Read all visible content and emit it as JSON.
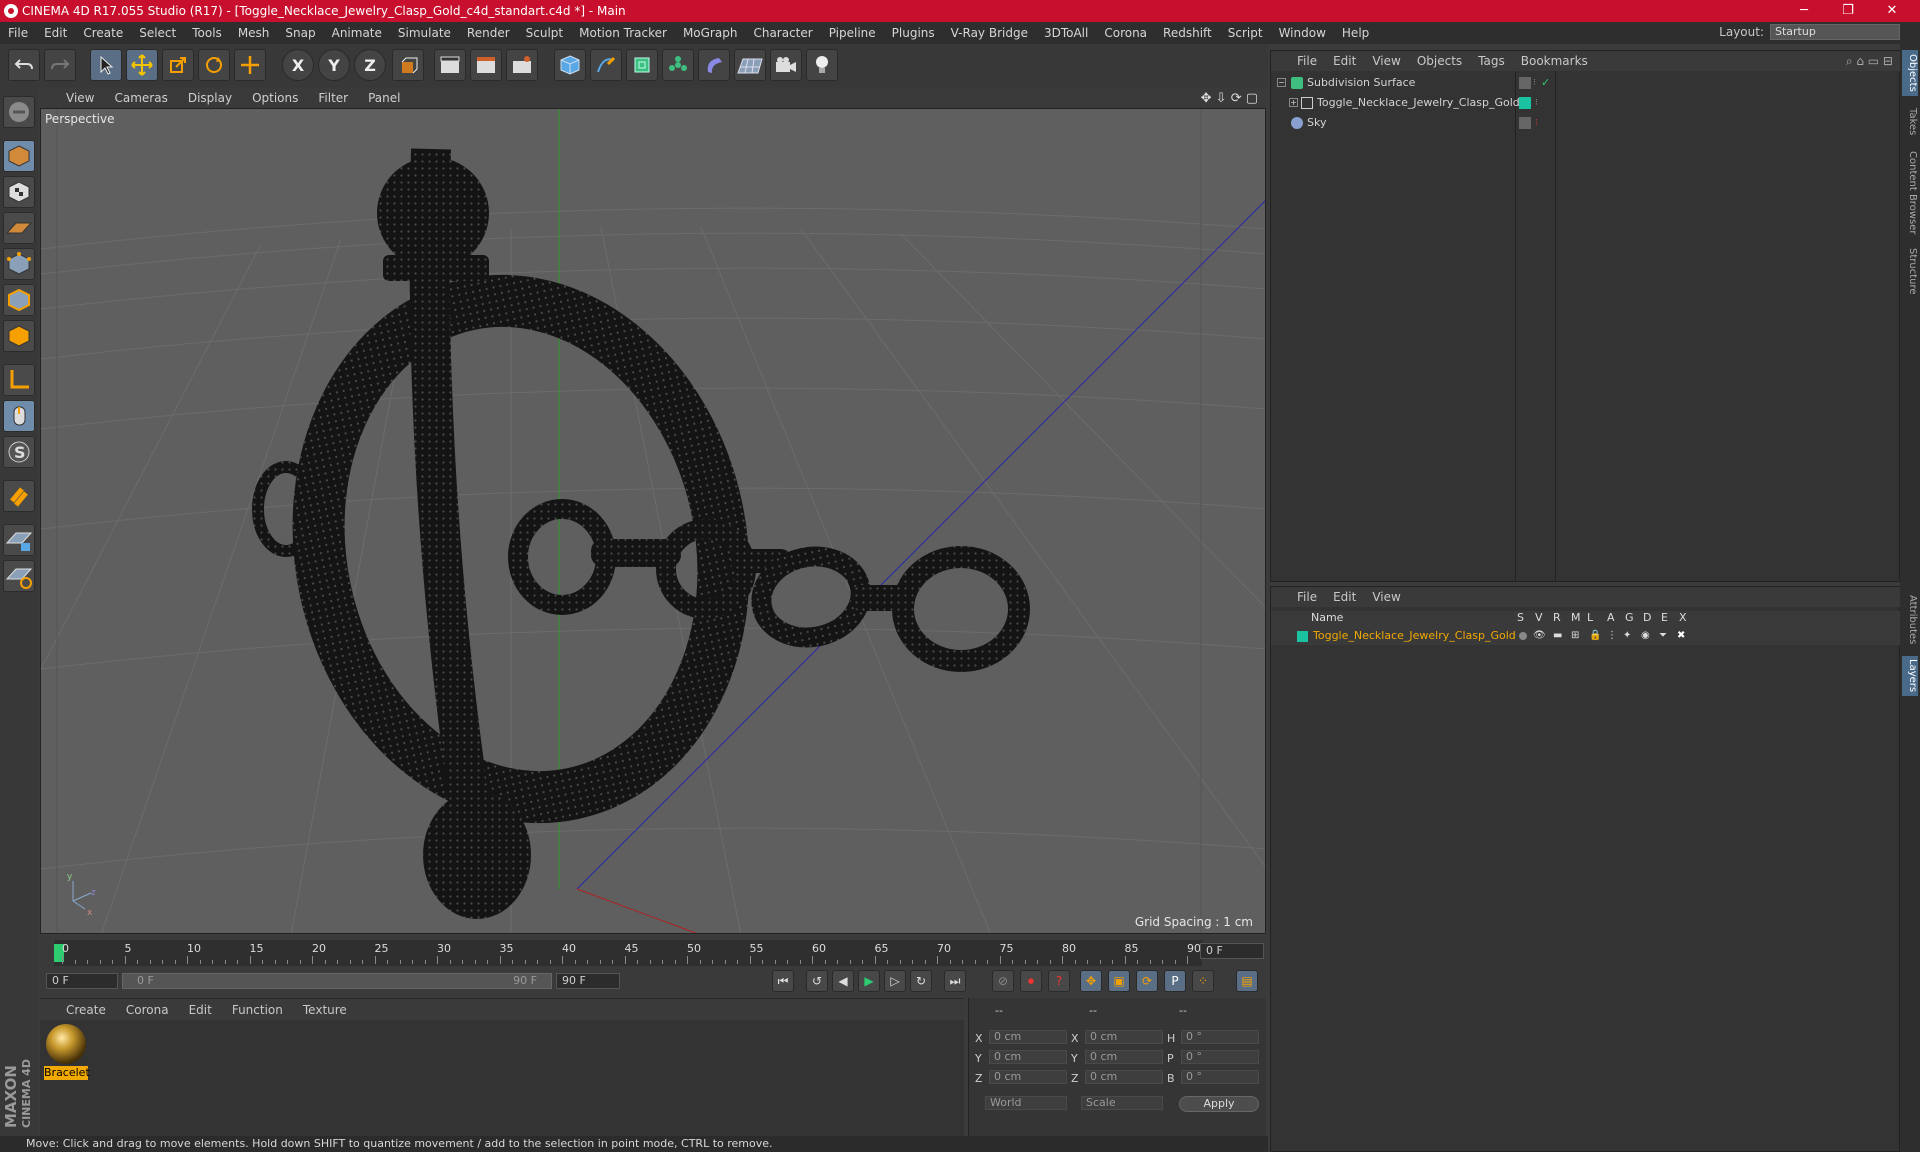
{
  "window": {
    "title": "CINEMA 4D R17.055 Studio (R17) - [Toggle_Necklace_Jewelry_Clasp_Gold_c4d_standart.c4d *] - Main",
    "minimize": "─",
    "maximize": "❐",
    "close": "✕"
  },
  "menubar": {
    "items": [
      "File",
      "Edit",
      "Create",
      "Select",
      "Tools",
      "Mesh",
      "Snap",
      "Animate",
      "Simulate",
      "Render",
      "Sculpt",
      "Motion Tracker",
      "MoGraph",
      "Character",
      "Pipeline",
      "Plugins",
      "V-Ray Bridge",
      "3DToAll",
      "Corona",
      "Redshift",
      "Script",
      "Window",
      "Help"
    ],
    "layout_label": "Layout:",
    "layout_value": "Startup"
  },
  "toolbar": {
    "axis_x": "X",
    "axis_y": "Y",
    "axis_z": "Z"
  },
  "viewport": {
    "menu": [
      "View",
      "Cameras",
      "Display",
      "Options",
      "Filter",
      "Panel"
    ],
    "label": "Perspective",
    "grid_spacing": "Grid Spacing : 1 cm"
  },
  "timeline": {
    "ticks": [
      "0",
      "5",
      "10",
      "15",
      "20",
      "25",
      "30",
      "35",
      "40",
      "45",
      "50",
      "55",
      "60",
      "65",
      "70",
      "75",
      "80",
      "85",
      "90"
    ],
    "current_frame": "0 F",
    "start_field": "0 F",
    "range_start": "0 F",
    "range_end": "90 F",
    "end_field": "90 F"
  },
  "material_manager": {
    "menu": [
      "Create",
      "Corona",
      "Edit",
      "Function",
      "Texture"
    ],
    "materials": [
      {
        "name": "Bracelet"
      }
    ]
  },
  "coordinates": {
    "header": [
      "--",
      "--",
      "--"
    ],
    "rows": [
      {
        "l1": "X",
        "v1": "0 cm",
        "l2": "X",
        "v2": "0 cm",
        "l3": "H",
        "v3": "0 °"
      },
      {
        "l1": "Y",
        "v1": "0 cm",
        "l2": "Y",
        "v2": "0 cm",
        "l3": "P",
        "v3": "0 °"
      },
      {
        "l1": "Z",
        "v1": "0 cm",
        "l2": "Z",
        "v2": "0 cm",
        "l3": "B",
        "v3": "0 °"
      }
    ],
    "mode": "World",
    "scale": "Scale",
    "apply": "Apply"
  },
  "status": "Move: Click and drag to move elements. Hold down SHIFT to quantize movement / add to the selection in point mode, CTRL to remove.",
  "object_manager": {
    "menu": [
      "File",
      "Edit",
      "View",
      "Objects",
      "Tags",
      "Bookmarks"
    ],
    "objects": [
      {
        "name": "Subdivision Surface"
      },
      {
        "name": "Toggle_Necklace_Jewelry_Clasp_Gold"
      },
      {
        "name": "Sky"
      }
    ]
  },
  "layer_manager": {
    "menu": [
      "File",
      "Edit",
      "View"
    ],
    "columns": [
      "Name",
      "S",
      "V",
      "R",
      "M",
      "L",
      "A",
      "G",
      "D",
      "E",
      "X"
    ],
    "layers": [
      {
        "name": "Toggle_Necklace_Jewelry_Clasp_Gold",
        "color": "#19c2a0"
      }
    ]
  },
  "right_tabs": [
    "Objects",
    "Takes",
    "Content Browser",
    "Structure",
    "Attributes",
    "Layers"
  ],
  "colors": {
    "accent": "#c8102e",
    "selected_layer_text": "#f2a900"
  }
}
